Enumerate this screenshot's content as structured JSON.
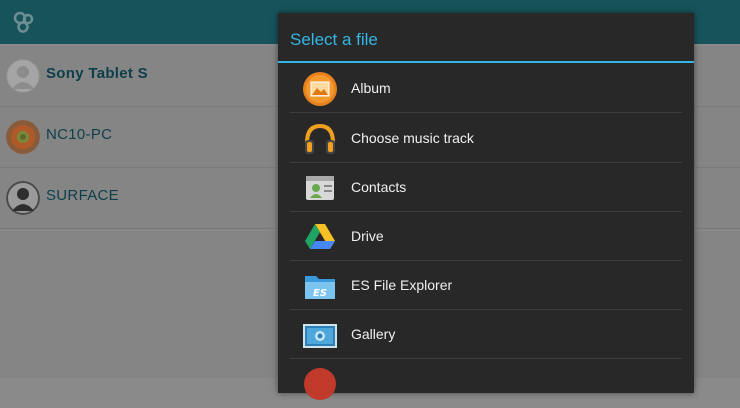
{
  "app": {
    "logo": "app-logo-icon",
    "devices": [
      {
        "name": "Sony Tablet S",
        "avatar": "tablet-avatar",
        "bold": true
      },
      {
        "name": "NC10-PC",
        "avatar": "flower-avatar",
        "bold": false
      },
      {
        "name": "SURFACE",
        "avatar": "person-avatar",
        "bold": false
      }
    ]
  },
  "dialog": {
    "title": "Select a file",
    "items": [
      {
        "label": "Album",
        "icon": "album-icon"
      },
      {
        "label": "Choose music track",
        "icon": "headphones-icon"
      },
      {
        "label": "Contacts",
        "icon": "contacts-icon"
      },
      {
        "label": "Drive",
        "icon": "drive-icon"
      },
      {
        "label": "ES File Explorer",
        "icon": "es-file-explorer-icon"
      },
      {
        "label": "Gallery",
        "icon": "gallery-icon"
      }
    ]
  },
  "colors": {
    "accent": "#33b5e5",
    "dialog_bg": "#282828",
    "actionbar": "#17535b"
  }
}
